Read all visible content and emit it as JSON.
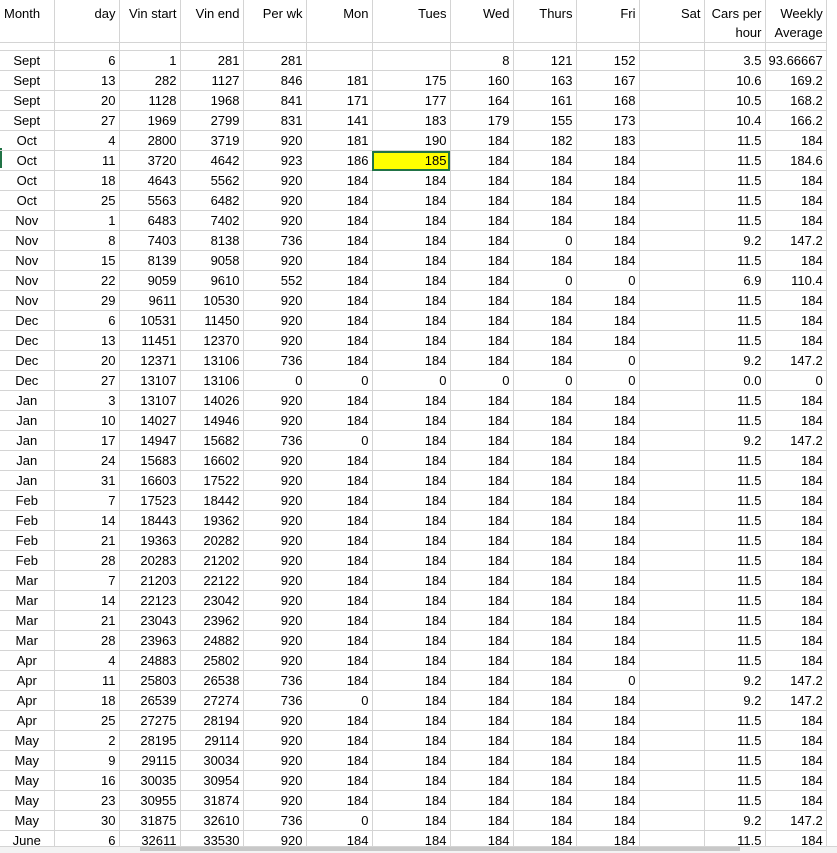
{
  "columns": [
    "Month",
    "day",
    "Vin start",
    "Vin end",
    "Per wk",
    "Mon",
    "Tues",
    "Wed",
    "Thurs",
    "Fri",
    "Sat",
    "Cars per hour",
    "Weekly Average"
  ],
  "rows": [
    [
      "Sept",
      "6",
      "1",
      "281",
      "281",
      "",
      "",
      "8",
      "121",
      "152",
      "",
      "3.5",
      "93.66667"
    ],
    [
      "Sept",
      "13",
      "282",
      "1127",
      "846",
      "181",
      "175",
      "160",
      "163",
      "167",
      "",
      "10.6",
      "169.2"
    ],
    [
      "Sept",
      "20",
      "1128",
      "1968",
      "841",
      "171",
      "177",
      "164",
      "161",
      "168",
      "",
      "10.5",
      "168.2"
    ],
    [
      "Sept",
      "27",
      "1969",
      "2799",
      "831",
      "141",
      "183",
      "179",
      "155",
      "173",
      "",
      "10.4",
      "166.2"
    ],
    [
      "Oct",
      "4",
      "2800",
      "3719",
      "920",
      "181",
      "190",
      "184",
      "182",
      "183",
      "",
      "11.5",
      "184"
    ],
    [
      "Oct",
      "11",
      "3720",
      "4642",
      "923",
      "186",
      "185",
      "184",
      "184",
      "184",
      "",
      "11.5",
      "184.6"
    ],
    [
      "Oct",
      "18",
      "4643",
      "5562",
      "920",
      "184",
      "184",
      "184",
      "184",
      "184",
      "",
      "11.5",
      "184"
    ],
    [
      "Oct",
      "25",
      "5563",
      "6482",
      "920",
      "184",
      "184",
      "184",
      "184",
      "184",
      "",
      "11.5",
      "184"
    ],
    [
      "Nov",
      "1",
      "6483",
      "7402",
      "920",
      "184",
      "184",
      "184",
      "184",
      "184",
      "",
      "11.5",
      "184"
    ],
    [
      "Nov",
      "8",
      "7403",
      "8138",
      "736",
      "184",
      "184",
      "184",
      "0",
      "184",
      "",
      "9.2",
      "147.2"
    ],
    [
      "Nov",
      "15",
      "8139",
      "9058",
      "920",
      "184",
      "184",
      "184",
      "184",
      "184",
      "",
      "11.5",
      "184"
    ],
    [
      "Nov",
      "22",
      "9059",
      "9610",
      "552",
      "184",
      "184",
      "184",
      "0",
      "0",
      "",
      "6.9",
      "110.4"
    ],
    [
      "Nov",
      "29",
      "9611",
      "10530",
      "920",
      "184",
      "184",
      "184",
      "184",
      "184",
      "",
      "11.5",
      "184"
    ],
    [
      "Dec",
      "6",
      "10531",
      "11450",
      "920",
      "184",
      "184",
      "184",
      "184",
      "184",
      "",
      "11.5",
      "184"
    ],
    [
      "Dec",
      "13",
      "11451",
      "12370",
      "920",
      "184",
      "184",
      "184",
      "184",
      "184",
      "",
      "11.5",
      "184"
    ],
    [
      "Dec",
      "20",
      "12371",
      "13106",
      "736",
      "184",
      "184",
      "184",
      "184",
      "0",
      "",
      "9.2",
      "147.2"
    ],
    [
      "Dec",
      "27",
      "13107",
      "13106",
      "0",
      "0",
      "0",
      "0",
      "0",
      "0",
      "",
      "0.0",
      "0"
    ],
    [
      "Jan",
      "3",
      "13107",
      "14026",
      "920",
      "184",
      "184",
      "184",
      "184",
      "184",
      "",
      "11.5",
      "184"
    ],
    [
      "Jan",
      "10",
      "14027",
      "14946",
      "920",
      "184",
      "184",
      "184",
      "184",
      "184",
      "",
      "11.5",
      "184"
    ],
    [
      "Jan",
      "17",
      "14947",
      "15682",
      "736",
      "0",
      "184",
      "184",
      "184",
      "184",
      "",
      "9.2",
      "147.2"
    ],
    [
      "Jan",
      "24",
      "15683",
      "16602",
      "920",
      "184",
      "184",
      "184",
      "184",
      "184",
      "",
      "11.5",
      "184"
    ],
    [
      "Jan",
      "31",
      "16603",
      "17522",
      "920",
      "184",
      "184",
      "184",
      "184",
      "184",
      "",
      "11.5",
      "184"
    ],
    [
      "Feb",
      "7",
      "17523",
      "18442",
      "920",
      "184",
      "184",
      "184",
      "184",
      "184",
      "",
      "11.5",
      "184"
    ],
    [
      "Feb",
      "14",
      "18443",
      "19362",
      "920",
      "184",
      "184",
      "184",
      "184",
      "184",
      "",
      "11.5",
      "184"
    ],
    [
      "Feb",
      "21",
      "19363",
      "20282",
      "920",
      "184",
      "184",
      "184",
      "184",
      "184",
      "",
      "11.5",
      "184"
    ],
    [
      "Feb",
      "28",
      "20283",
      "21202",
      "920",
      "184",
      "184",
      "184",
      "184",
      "184",
      "",
      "11.5",
      "184"
    ],
    [
      "Mar",
      "7",
      "21203",
      "22122",
      "920",
      "184",
      "184",
      "184",
      "184",
      "184",
      "",
      "11.5",
      "184"
    ],
    [
      "Mar",
      "14",
      "22123",
      "23042",
      "920",
      "184",
      "184",
      "184",
      "184",
      "184",
      "",
      "11.5",
      "184"
    ],
    [
      "Mar",
      "21",
      "23043",
      "23962",
      "920",
      "184",
      "184",
      "184",
      "184",
      "184",
      "",
      "11.5",
      "184"
    ],
    [
      "Mar",
      "28",
      "23963",
      "24882",
      "920",
      "184",
      "184",
      "184",
      "184",
      "184",
      "",
      "11.5",
      "184"
    ],
    [
      "Apr",
      "4",
      "24883",
      "25802",
      "920",
      "184",
      "184",
      "184",
      "184",
      "184",
      "",
      "11.5",
      "184"
    ],
    [
      "Apr",
      "11",
      "25803",
      "26538",
      "736",
      "184",
      "184",
      "184",
      "184",
      "0",
      "",
      "9.2",
      "147.2"
    ],
    [
      "Apr",
      "18",
      "26539",
      "27274",
      "736",
      "0",
      "184",
      "184",
      "184",
      "184",
      "",
      "9.2",
      "147.2"
    ],
    [
      "Apr",
      "25",
      "27275",
      "28194",
      "920",
      "184",
      "184",
      "184",
      "184",
      "184",
      "",
      "11.5",
      "184"
    ],
    [
      "May",
      "2",
      "28195",
      "29114",
      "920",
      "184",
      "184",
      "184",
      "184",
      "184",
      "",
      "11.5",
      "184"
    ],
    [
      "May",
      "9",
      "29115",
      "30034",
      "920",
      "184",
      "184",
      "184",
      "184",
      "184",
      "",
      "11.5",
      "184"
    ],
    [
      "May",
      "16",
      "30035",
      "30954",
      "920",
      "184",
      "184",
      "184",
      "184",
      "184",
      "",
      "11.5",
      "184"
    ],
    [
      "May",
      "23",
      "30955",
      "31874",
      "920",
      "184",
      "184",
      "184",
      "184",
      "184",
      "",
      "11.5",
      "184"
    ],
    [
      "May",
      "30",
      "31875",
      "32610",
      "736",
      "0",
      "184",
      "184",
      "184",
      "184",
      "",
      "9.2",
      "147.2"
    ],
    [
      "June",
      "6",
      "32611",
      "33530",
      "920",
      "184",
      "184",
      "184",
      "184",
      "184",
      "",
      "11.5",
      "184"
    ]
  ],
  "selected_cell": {
    "row": 5,
    "col": 6
  },
  "colors": {
    "highlight": "#ffff00",
    "selection_border": "#217346",
    "gridline": "#d4d4d4"
  }
}
